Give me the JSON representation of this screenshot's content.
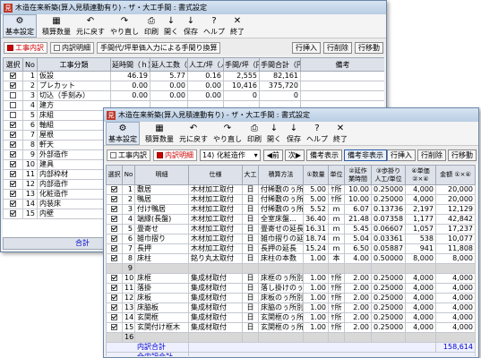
{
  "window_back": {
    "title": "木造在来新築(算入見積連動有り) - ザ・大工手間 : 書式設定",
    "toolbar": [
      {
        "label": "基本設定",
        "icon": "⚙"
      },
      {
        "label": "積算数量",
        "icon": "▦"
      },
      {
        "label": "元に戻す",
        "icon": "↶"
      },
      {
        "label": "やり直し",
        "icon": "↷"
      },
      {
        "label": "印刷",
        "icon": "⎙"
      },
      {
        "label": "開く",
        "icon": "↓"
      },
      {
        "label": "保存",
        "icon": "↓"
      },
      {
        "label": "ヘルプ",
        "icon": "?"
      },
      {
        "label": "終了",
        "icon": "✕"
      }
    ],
    "tabs": [
      "工事内訳",
      "内訳明細",
      "手間代/坪単価入力による手間り換算"
    ],
    "actions": [
      "行挿入",
      "行削除",
      "行移動"
    ],
    "headers": [
      "選択",
      "No",
      "工事分類",
      "延時間（ｈ）",
      "延人工数（人）",
      "人工/坪（人／坪）",
      "手間/坪（円）",
      "手間合計（円）",
      "備考"
    ],
    "rows": [
      [
        "1",
        "仮設",
        "46.19",
        "5.77",
        "0.16",
        "2,555",
        "82,161"
      ],
      [
        "2",
        "プレカット",
        "0.00",
        "0.00",
        "0.00",
        "10,416",
        "375,720"
      ],
      [
        "3",
        "切込（手刻み）",
        "0.00",
        "0.00",
        "0.00",
        "0",
        "0"
      ],
      [
        "4",
        "建方",
        "",
        "",
        "",
        "",
        ""
      ],
      [
        "5",
        "床組",
        "",
        "",
        "",
        "",
        ""
      ],
      [
        "6",
        "軸組",
        "",
        "",
        "",
        "",
        ""
      ],
      [
        "7",
        "屋根",
        "",
        "",
        "",
        "",
        ""
      ],
      [
        "8",
        "軒天",
        "",
        "",
        "",
        "",
        ""
      ],
      [
        "9",
        "外部造作",
        "",
        "",
        "",
        "",
        ""
      ],
      [
        "10",
        "建具",
        "",
        "",
        "",
        "",
        ""
      ],
      [
        "11",
        "内部枠材",
        "",
        "",
        "",
        "",
        ""
      ],
      [
        "12",
        "内部造作",
        "",
        "",
        "",
        "",
        ""
      ],
      [
        "13",
        "化粧造作",
        "",
        "",
        "",
        "",
        ""
      ],
      [
        "14",
        "内装床",
        "",
        "",
        "",
        "",
        ""
      ],
      [
        "15",
        "内壁",
        "",
        "",
        "",
        "",
        ""
      ]
    ],
    "footer_label": "合計"
  },
  "window_front": {
    "title": "木造在来新築(算入見積連動有り) - ザ・大工手間 : 書式設定",
    "toolbar": [
      {
        "label": "基本設定",
        "icon": "⚙"
      },
      {
        "label": "積算数量",
        "icon": "▦"
      },
      {
        "label": "元に戻す",
        "icon": "↶"
      },
      {
        "label": "やり直し",
        "icon": "↷"
      },
      {
        "label": "印刷",
        "icon": "⎙"
      },
      {
        "label": "開く",
        "icon": "↓"
      },
      {
        "label": "保存",
        "icon": "↓"
      },
      {
        "label": "ヘルプ",
        "icon": "?"
      },
      {
        "label": "終了",
        "icon": "✕"
      }
    ],
    "tabs": [
      "工事内訳",
      "内訳明細"
    ],
    "combo": "14) 化粧造作",
    "prev": "前",
    "next": "次",
    "toggle": "備考表示",
    "toggle2": "備考非表示",
    "actions": [
      "行挿入",
      "行削除",
      "行移動"
    ],
    "headers": [
      "選択",
      "No",
      "明細",
      "仕様",
      "大工",
      "積算方法",
      "①数量",
      "単位",
      "②延作業時間",
      "③歩掛り 人工/単位",
      "④単価 ②×④",
      "金額 ①×④"
    ],
    "rows": [
      [
        "1",
        "敷居",
        "木材加工取付",
        "日",
        "付稀敷のぅ所別",
        "5.00",
        "ｹ所",
        "10.00",
        "0.25000",
        "4,000",
        "20,000",
        "c"
      ],
      [
        "2",
        "鴨居",
        "木材加工取付",
        "日",
        "付稀敷のぅ所別",
        "5.00",
        "ｹ所",
        "10.00",
        "0.25000",
        "4,000",
        "20,000",
        "c"
      ],
      [
        "3",
        "付け鴨居",
        "木材加工取付",
        "日",
        "付稀敷のぅ所別",
        "5.52",
        "m",
        "6.07",
        "0.13736",
        "2,197",
        "12,129",
        "c"
      ],
      [
        "4",
        "端縁(長盤)",
        "木材加工取付",
        "日",
        "全室床盤…",
        "36.40",
        "m",
        "21.48",
        "0.07358",
        "1,177",
        "42,842",
        "c"
      ],
      [
        "5",
        "畳寄せ",
        "木材加工取付",
        "日",
        "畳寄せの延長",
        "16.31",
        "m",
        "5.45",
        "0.06607",
        "1,057",
        "17,237",
        "c"
      ],
      [
        "6",
        "雑巾摺り",
        "木材加工取付",
        "日",
        "雑巾摺りの延長",
        "18.74",
        "m",
        "5.04",
        "0.03361",
        "538",
        "10,077",
        "c"
      ],
      [
        "7",
        "長押",
        "木材加工取付",
        "日",
        "長押の延長",
        "15.24",
        "m",
        "6.50",
        "0.05887",
        "941",
        "11,808",
        "c"
      ],
      [
        "8",
        "床柱",
        "銘り丸太取付",
        "日",
        "床柱の本数",
        "1.00",
        "本",
        "4.00",
        "0.50000",
        "8,000",
        "8,000",
        "c"
      ],
      [
        "9",
        "",
        "",
        "",
        "",
        "",
        "",
        "",
        "",
        "",
        "",
        "g"
      ],
      [
        "10",
        "床框",
        "集成材取付",
        "日",
        "床框のぅ所別",
        "1.00",
        "ｹ所",
        "2.00",
        "0.25000",
        "4,000",
        "4,000",
        "c"
      ],
      [
        "11",
        "落掛",
        "集成材取付",
        "日",
        "落し掛けのぅ所",
        "1.00",
        "ｹ所",
        "2.00",
        "0.25000",
        "4,000",
        "4,000",
        "c"
      ],
      [
        "12",
        "床板",
        "集成材取付",
        "日",
        "床板のぅ所別",
        "1.00",
        "ｹ所",
        "2.00",
        "0.25000",
        "4,000",
        "4,000",
        "c"
      ],
      [
        "13",
        "床脇板",
        "集成材取付",
        "日",
        "床脇のぅ所別",
        "1.00",
        "ｹ所",
        "2.00",
        "0.25000",
        "4,000",
        "4,000",
        "c"
      ],
      [
        "14",
        "玄関框",
        "集成材取付",
        "日",
        "玄関框のぅ所",
        "1.00",
        "ｹ所",
        "2.00",
        "0.25000",
        "4,000",
        "4,000",
        "c"
      ],
      [
        "15",
        "玄関付け框木",
        "集成材取付",
        "日",
        "玄関框のぅ所",
        "1.00",
        "ｹ所",
        "2.00",
        "0.25000",
        "4,000",
        "4,000",
        "c"
      ],
      [
        "16",
        "",
        "",
        "",
        "",
        "",
        "",
        "",
        "",
        "",
        "",
        "g"
      ]
    ],
    "subtotal_label": "内訳合計",
    "subtotal_value": "158,614",
    "subtotal2_label": "全内訳合計"
  }
}
